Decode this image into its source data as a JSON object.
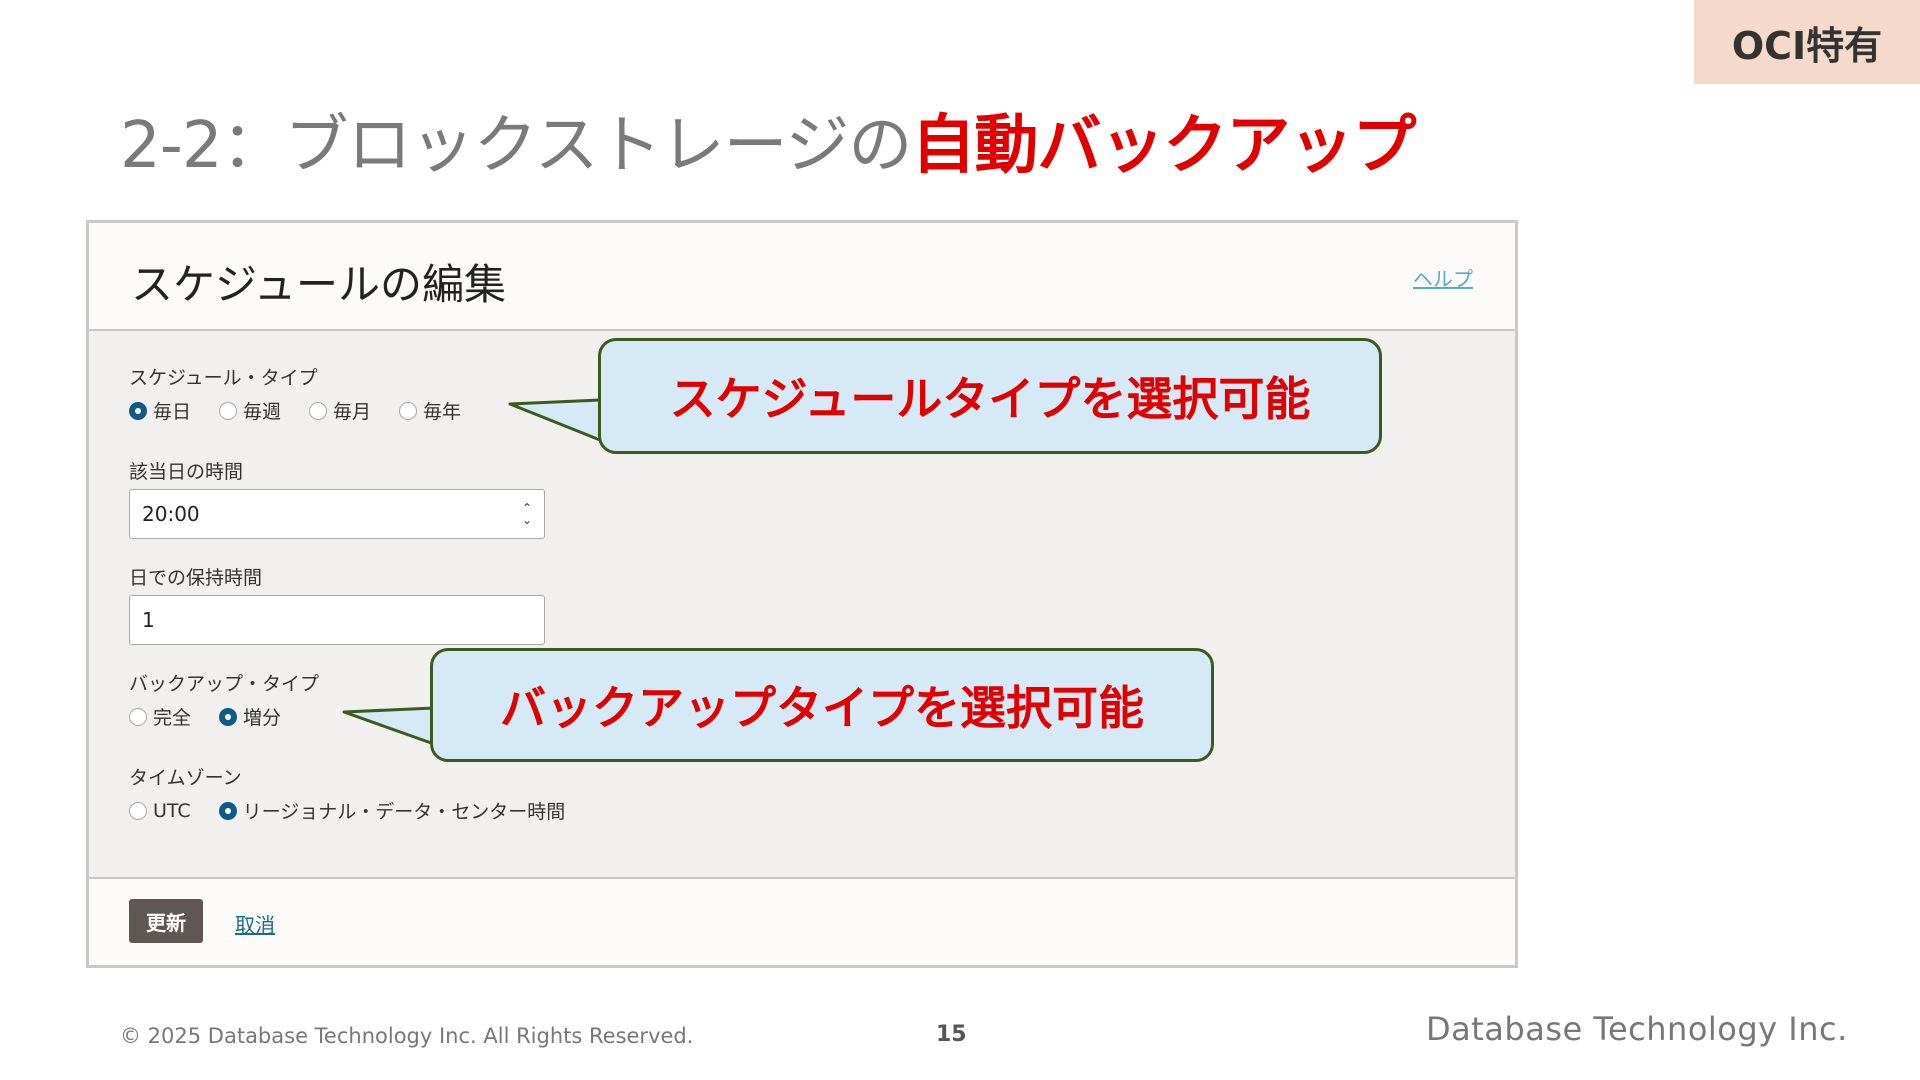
{
  "badge": "OCI特有",
  "title": {
    "prefix": "2-2：ブロックストレージの",
    "highlight": "自動バックアップ"
  },
  "dialog": {
    "title": "スケジュールの編集",
    "help": "ヘルプ",
    "schedule_type": {
      "label": "スケジュール・タイプ",
      "options": [
        "毎日",
        "毎週",
        "毎月",
        "毎年"
      ],
      "selected": "毎日"
    },
    "time_of_day": {
      "label": "該当日の時間",
      "value": "20:00"
    },
    "retention": {
      "label": "日での保持時間",
      "value": "1"
    },
    "backup_type": {
      "label": "バックアップ・タイプ",
      "options": [
        "完全",
        "増分"
      ],
      "selected": "増分"
    },
    "timezone": {
      "label": "タイムゾーン",
      "options": [
        "UTC",
        "リージョナル・データ・センター時間"
      ],
      "selected": "リージョナル・データ・センター時間"
    },
    "buttons": {
      "update": "更新",
      "cancel": "取消"
    }
  },
  "callouts": {
    "schedule": "スケジュールタイプを選択可能",
    "backup": "バックアップタイプを選択可能"
  },
  "footer": {
    "copyright": "© 2025 Database Technology Inc. All Rights Reserved.",
    "page_number": "15",
    "brand": "Database Technology Inc."
  },
  "colors": {
    "accent_red": "#e00000",
    "radio_selected": "#0f5a86",
    "callout_fill": "#d5e9f6",
    "badge_bg": "#f5d9cb"
  }
}
